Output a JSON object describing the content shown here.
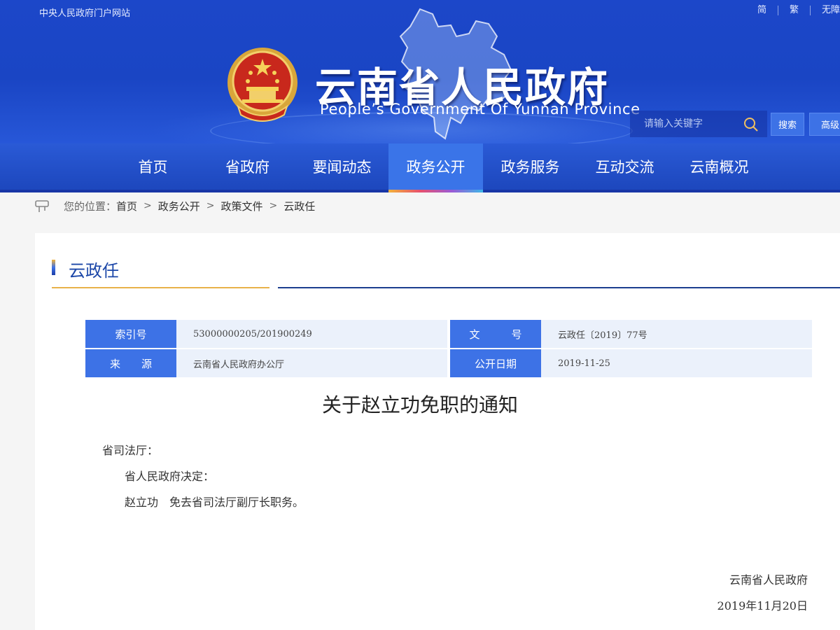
{
  "header": {
    "portal_link": "中央人民政府门户网站",
    "lang": [
      "简",
      "繁",
      "无障"
    ],
    "title": "云南省人民政府",
    "subtitle": "People’s Government Of Yunnan Province",
    "search": {
      "placeholder": "请输入关键字",
      "search_label": "搜索",
      "advanced_label": "高级"
    }
  },
  "nav": {
    "items": [
      "首页",
      "省政府",
      "要闻动态",
      "政务公开",
      "政务服务",
      "互动交流",
      "云南概况"
    ],
    "active": "政务公开"
  },
  "breadcrumb": {
    "label": "您的位置：",
    "items": [
      "首页",
      "政务公开",
      "政策文件",
      "云政任"
    ]
  },
  "section": {
    "title": "云政任"
  },
  "meta": {
    "index_label": "索引号",
    "index_value": "53000000205/201900249",
    "docno_label": "文　　　号",
    "docno_value": "云政任〔2019〕77号",
    "source_label": "来　　源",
    "source_value": "云南省人民政府办公厅",
    "date_label": "公开日期",
    "date_value": "2019-11-25"
  },
  "document": {
    "title": "关于赵立功免职的通知",
    "salutation": "省司法厅：",
    "paragraphs": [
      "省人民政府决定：",
      "赵立功　免去省司法厅副厅长职务。"
    ],
    "signature": "云南省人民政府",
    "date": "2019年11月20日"
  },
  "colors": {
    "header_blue": "#1c47c9",
    "nav_active": "#3a74e8",
    "label_blue": "#3d72e6",
    "gold": "#e8b24a"
  }
}
